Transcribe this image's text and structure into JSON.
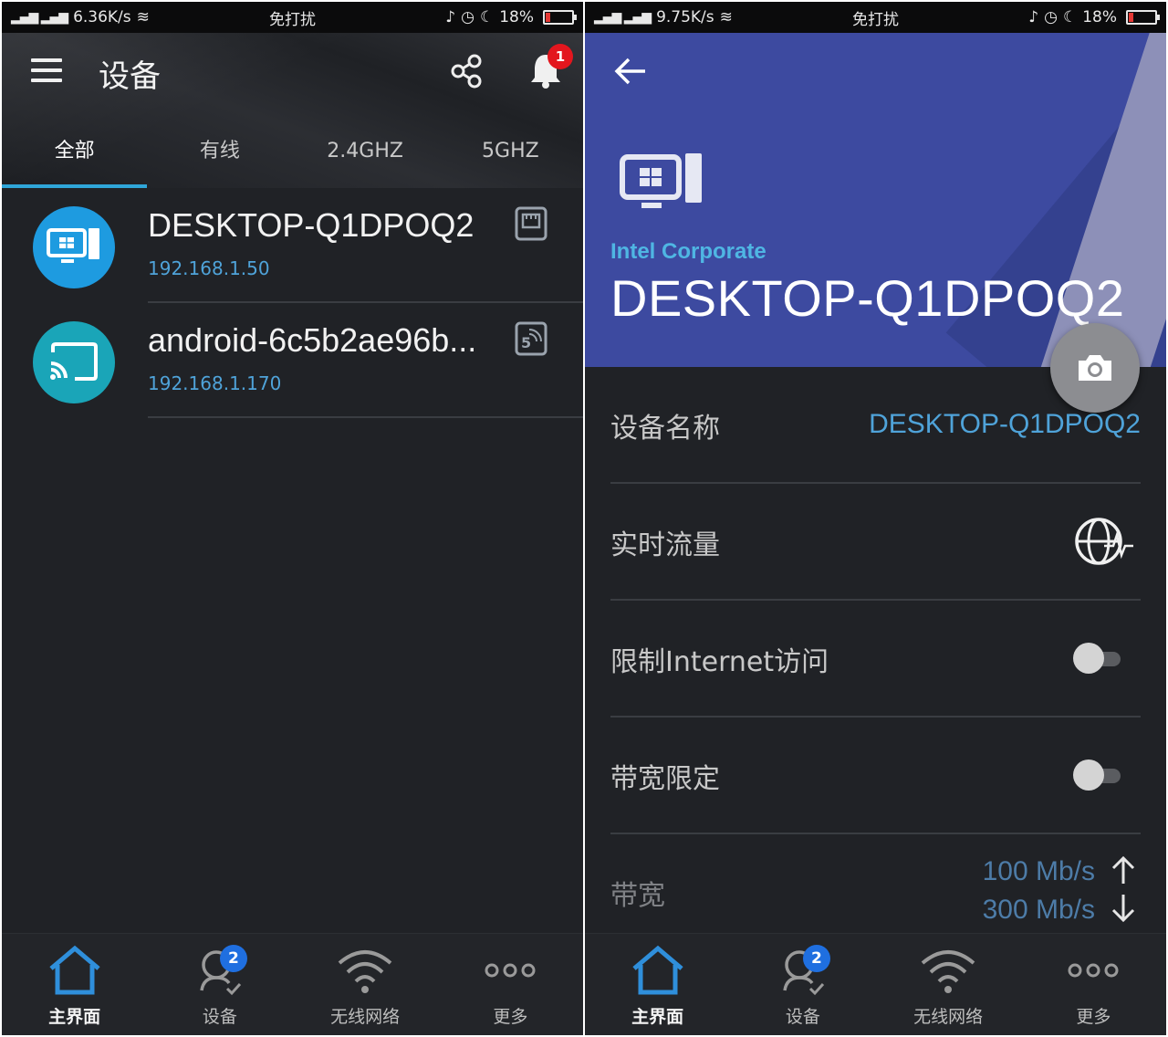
{
  "left": {
    "status": {
      "speed": "6.36K/s",
      "center": "免打扰",
      "battery": "18%"
    },
    "title": "设备",
    "notification_count": "1",
    "tabs": [
      "全部",
      "有线",
      "2.4GHZ",
      "5GHZ"
    ],
    "devices": [
      {
        "name": "DESKTOP-Q1DPOQ2",
        "ip": "192.168.1.50",
        "avatar_color": "#1e9be0",
        "type_icon": "ethernet-icon"
      },
      {
        "name": "android-6c5b2ae96b...",
        "ip": "192.168.1.170",
        "avatar_color": "#1aa5b8",
        "type_icon": "wifi-5g-icon"
      }
    ]
  },
  "right": {
    "status": {
      "speed": "9.75K/s",
      "center": "免打扰",
      "battery": "18%"
    },
    "vendor": "Intel Corporate",
    "device_name": "DESKTOP-Q1DPOQ2",
    "settings": {
      "name_label": "设备名称",
      "name_value": "DESKTOP-Q1DPOQ2",
      "traffic_label": "实时流量",
      "limit_internet_label": "限制Internet访问",
      "bandwidth_limit_label": "带宽限定",
      "bandwidth_label": "带宽",
      "upload": "100 Mb/s",
      "download": "300 Mb/s"
    }
  },
  "nav": {
    "home": "主界面",
    "devices": "设备",
    "wireless": "无线网络",
    "more": "更多",
    "devices_badge": "2"
  },
  "colors": {
    "accent_blue": "#4fa3d9",
    "header_purple": "#3d4aa0",
    "badge_red": "#e3161e",
    "badge_blue": "#1f6fe0"
  }
}
